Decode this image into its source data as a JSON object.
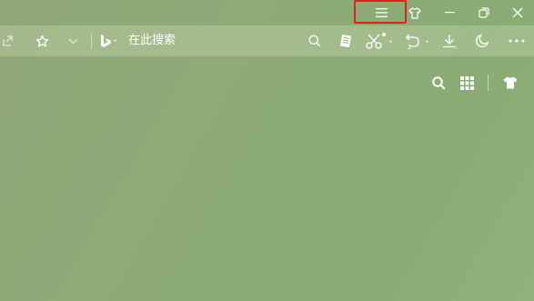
{
  "titlebar": {
    "buttons": [
      {
        "name": "menu",
        "icon": "hamburger-menu-icon"
      },
      {
        "name": "skin",
        "icon": "tshirt-icon"
      },
      {
        "name": "minimize",
        "icon": "minimize-icon"
      },
      {
        "name": "restore",
        "icon": "restore-icon"
      },
      {
        "name": "close",
        "icon": "close-icon"
      }
    ],
    "highlight_color": "#e0221b"
  },
  "toolbar": {
    "search_placeholder": "在此搜索",
    "search_engine_icon": "bing-logo-icon",
    "icons": [
      "share-icon",
      "star-icon",
      "chevron-down-icon",
      "search-icon",
      "document-icon",
      "scissors-icon",
      "undo-icon",
      "download-icon",
      "moon-icon",
      "more-icon"
    ]
  },
  "new_tab": {
    "icons": [
      "search-icon",
      "grid-icon",
      "tshirt-icon"
    ]
  },
  "colors": {
    "background": "#8fab78",
    "icon": "#ffffff"
  }
}
